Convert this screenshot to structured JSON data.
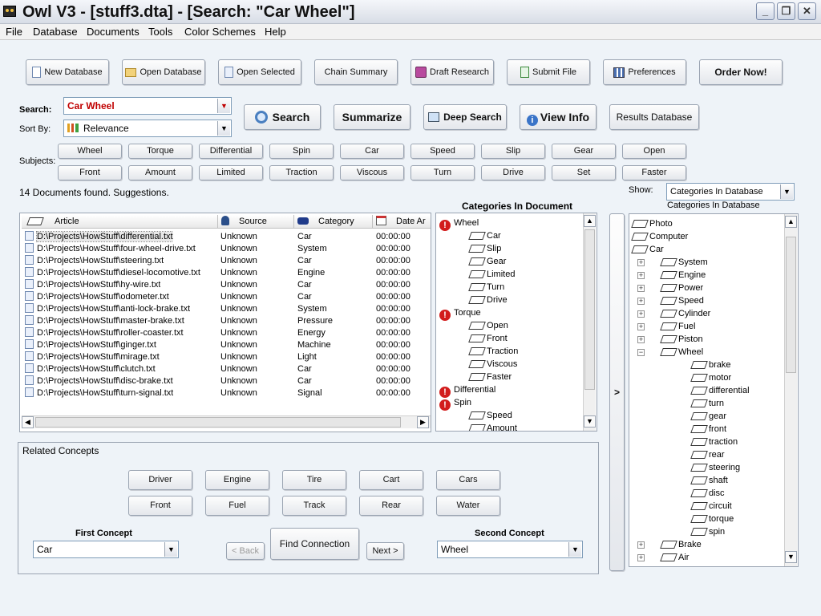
{
  "window": {
    "title": "Owl V3 - [stuff3.dta] - [Search: \"Car Wheel\"]",
    "controls": [
      "_",
      "❐",
      "✕"
    ]
  },
  "menu": [
    "File",
    "Database",
    "Documents",
    "Tools",
    "Color Schemes",
    "Help"
  ],
  "toolbar": {
    "new_database": "New Database",
    "open_database": "Open Database",
    "open_selected": "Open Selected",
    "chain_summary": "Chain Summary",
    "draft_research": "Draft Research",
    "submit_file": "Submit File",
    "preferences": "Preferences",
    "order_now": "Order Now!"
  },
  "search": {
    "label": "Search:",
    "value": "Car Wheel",
    "sort_label": "Sort By:",
    "sort_value": "Relevance",
    "search_btn": "Search",
    "summarize_btn": "Summarize",
    "deep_search_btn": "Deep Search",
    "view_info_btn": "View Info",
    "results_db_btn": "Results Database"
  },
  "subjects": {
    "label": "Subjects:",
    "row1": [
      "Wheel",
      "Torque",
      "Differential",
      "Spin",
      "Car",
      "Speed",
      "Slip",
      "Gear",
      "Open"
    ],
    "row2": [
      "Front",
      "Amount",
      "Limited",
      "Traction",
      "Viscous",
      "Turn",
      "Drive",
      "Set",
      "Faster"
    ]
  },
  "status": "14 Documents found. Suggestions.",
  "show": {
    "label": "Show:",
    "value": "Categories In Database",
    "caption": "Categories In Database"
  },
  "results": {
    "columns": [
      "Article",
      "Source",
      "Category",
      "Date Ar"
    ],
    "rows": [
      [
        "D:\\Projects\\HowStuff\\differential.txt",
        "Unknown",
        "Car",
        "00:00:00"
      ],
      [
        "D:\\Projects\\HowStuff\\four-wheel-drive.txt",
        "Unknown",
        "System",
        "00:00:00"
      ],
      [
        "D:\\Projects\\HowStuff\\steering.txt",
        "Unknown",
        "Car",
        "00:00:00"
      ],
      [
        "D:\\Projects\\HowStuff\\diesel-locomotive.txt",
        "Unknown",
        "Engine",
        "00:00:00"
      ],
      [
        "D:\\Projects\\HowStuff\\hy-wire.txt",
        "Unknown",
        "Car",
        "00:00:00"
      ],
      [
        "D:\\Projects\\HowStuff\\odometer.txt",
        "Unknown",
        "Car",
        "00:00:00"
      ],
      [
        "D:\\Projects\\HowStuff\\anti-lock-brake.txt",
        "Unknown",
        "System",
        "00:00:00"
      ],
      [
        "D:\\Projects\\HowStuff\\master-brake.txt",
        "Unknown",
        "Pressure",
        "00:00:00"
      ],
      [
        "D:\\Projects\\HowStuff\\roller-coaster.txt",
        "Unknown",
        "Energy",
        "00:00:00"
      ],
      [
        "D:\\Projects\\HowStuff\\ginger.txt",
        "Unknown",
        "Machine",
        "00:00:00"
      ],
      [
        "D:\\Projects\\HowStuff\\mirage.txt",
        "Unknown",
        "Light",
        "00:00:00"
      ],
      [
        "D:\\Projects\\HowStuff\\clutch.txt",
        "Unknown",
        "Car",
        "00:00:00"
      ],
      [
        "D:\\Projects\\HowStuff\\disc-brake.txt",
        "Unknown",
        "Car",
        "00:00:00"
      ],
      [
        "D:\\Projects\\HowStuff\\turn-signal.txt",
        "Unknown",
        "Signal",
        "00:00:00"
      ]
    ]
  },
  "doc_categories": {
    "title": "Categories In Document",
    "items": [
      {
        "label": "Wheel",
        "level": 0
      },
      {
        "label": "Car",
        "level": 1
      },
      {
        "label": "Slip",
        "level": 1
      },
      {
        "label": "Gear",
        "level": 1
      },
      {
        "label": "Limited",
        "level": 1
      },
      {
        "label": "Turn",
        "level": 1
      },
      {
        "label": "Drive",
        "level": 1
      },
      {
        "label": "Torque",
        "level": 0
      },
      {
        "label": "Open",
        "level": 1
      },
      {
        "label": "Front",
        "level": 1
      },
      {
        "label": "Traction",
        "level": 1
      },
      {
        "label": "Viscous",
        "level": 1
      },
      {
        "label": "Faster",
        "level": 1
      },
      {
        "label": "Differential",
        "level": 0
      },
      {
        "label": "Spin",
        "level": 0
      },
      {
        "label": "Speed",
        "level": 1
      },
      {
        "label": "Amount",
        "level": 1
      }
    ]
  },
  "transfer_btn": ">",
  "db_categories": {
    "items": [
      {
        "label": "Photo",
        "level": 0,
        "exp": ""
      },
      {
        "label": "Computer",
        "level": 0,
        "exp": ""
      },
      {
        "label": "Car",
        "level": 0,
        "exp": ""
      },
      {
        "label": "System",
        "level": 1,
        "exp": "+"
      },
      {
        "label": "Engine",
        "level": 1,
        "exp": "+"
      },
      {
        "label": "Power",
        "level": 1,
        "exp": "+"
      },
      {
        "label": "Speed",
        "level": 1,
        "exp": "+"
      },
      {
        "label": "Cylinder",
        "level": 1,
        "exp": "+"
      },
      {
        "label": "Fuel",
        "level": 1,
        "exp": "+"
      },
      {
        "label": "Piston",
        "level": 1,
        "exp": "+"
      },
      {
        "label": "Wheel",
        "level": 1,
        "exp": "−"
      },
      {
        "label": "brake",
        "level": 2,
        "exp": ""
      },
      {
        "label": "motor",
        "level": 2,
        "exp": ""
      },
      {
        "label": "differential",
        "level": 2,
        "exp": ""
      },
      {
        "label": "turn",
        "level": 2,
        "exp": ""
      },
      {
        "label": "gear",
        "level": 2,
        "exp": ""
      },
      {
        "label": "front",
        "level": 2,
        "exp": ""
      },
      {
        "label": "traction",
        "level": 2,
        "exp": ""
      },
      {
        "label": "rear",
        "level": 2,
        "exp": ""
      },
      {
        "label": "steering",
        "level": 2,
        "exp": ""
      },
      {
        "label": "shaft",
        "level": 2,
        "exp": ""
      },
      {
        "label": "disc",
        "level": 2,
        "exp": ""
      },
      {
        "label": "circuit",
        "level": 2,
        "exp": ""
      },
      {
        "label": "torque",
        "level": 2,
        "exp": ""
      },
      {
        "label": "spin",
        "level": 2,
        "exp": ""
      },
      {
        "label": "Brake",
        "level": 1,
        "exp": "+"
      },
      {
        "label": "Air",
        "level": 1,
        "exp": "+"
      }
    ]
  },
  "related": {
    "title": "Related Concepts",
    "row1": [
      "Driver",
      "Engine",
      "Tire",
      "Cart",
      "Cars"
    ],
    "row2": [
      "Front",
      "Fuel",
      "Track",
      "Rear",
      "Water"
    ],
    "first_label": "First Concept",
    "first_value": "Car",
    "second_label": "Second Concept",
    "second_value": "Wheel",
    "back": "< Back",
    "find": "Find Connection",
    "next": "Next >"
  }
}
